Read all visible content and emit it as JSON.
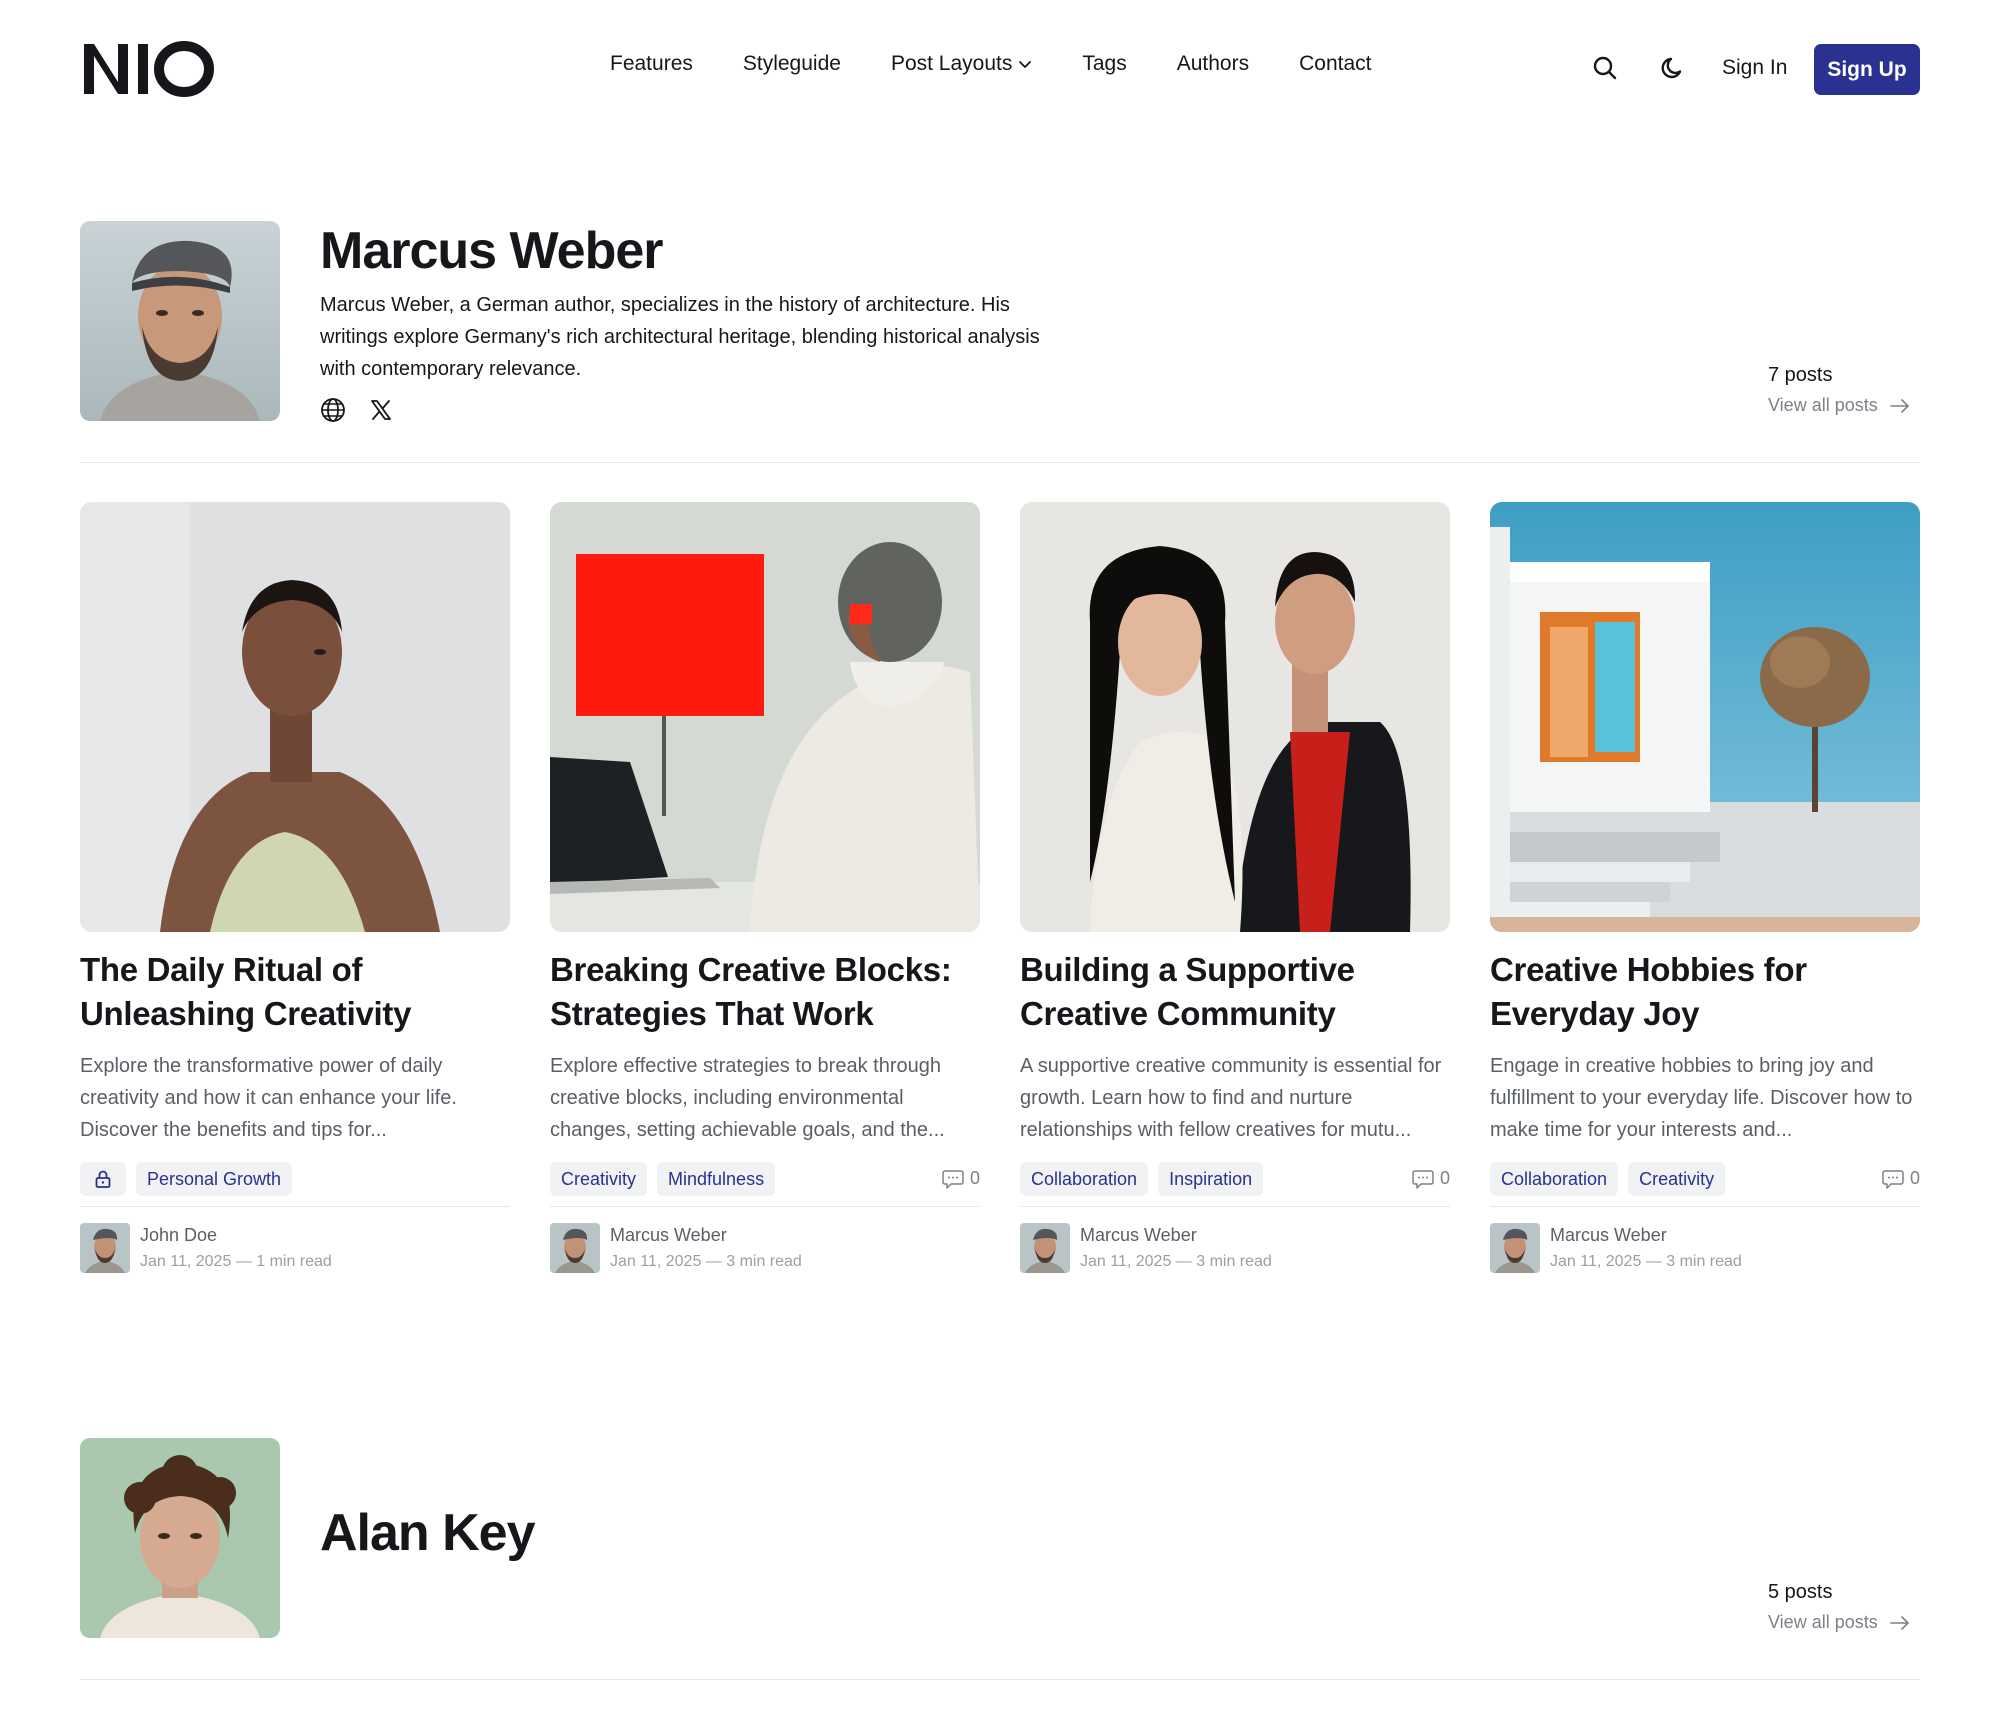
{
  "header": {
    "logo_text": "NIO",
    "nav": [
      {
        "label": "Features"
      },
      {
        "label": "Styleguide"
      },
      {
        "label": "Post Layouts"
      },
      {
        "label": "Tags"
      },
      {
        "label": "Authors"
      },
      {
        "label": "Contact"
      }
    ],
    "signin_label": "Sign In",
    "signup_label": "Sign Up",
    "accent_color": "#2b3190"
  },
  "authors": [
    {
      "name": "Marcus Weber",
      "bio": "Marcus Weber, a German author, specializes in the history of architecture. His writings explore Germany's rich architectural heritage, blending historical analysis with contemporary relevance.",
      "post_count": "7 posts",
      "view_all_label": "View all posts",
      "socials": [
        "globe-icon",
        "x-icon"
      ]
    },
    {
      "name": "Alan Key",
      "post_count": "5 posts",
      "view_all_label": "View all posts"
    }
  ],
  "posts": [
    {
      "title": "The Daily Ritual of Unleashing Creativity",
      "excerpt": "Explore the transformative power of daily creativity and how it can enhance your life. Discover the benefits and tips for...",
      "locked": true,
      "tags": [
        "Personal Growth"
      ],
      "comments": "",
      "author": "John Doe",
      "meta": "Jan 11, 2025 — 1 min read"
    },
    {
      "title": "Breaking Creative Blocks: Strategies That Work",
      "excerpt": "Explore effective strategies to break through creative blocks, including environmental changes, setting achievable goals, and the...",
      "locked": false,
      "tags": [
        "Creativity",
        "Mindfulness"
      ],
      "comments": "0",
      "author": "Marcus Weber",
      "meta": "Jan 11, 2025 — 3 min read"
    },
    {
      "title": "Building a Supportive Creative Community",
      "excerpt": "A supportive creative community is essential for growth. Learn how to find and nurture relationships with fellow creatives for mutu...",
      "locked": false,
      "tags": [
        "Collaboration",
        "Inspiration"
      ],
      "comments": "0",
      "author": "Marcus Weber",
      "meta": "Jan 11, 2025 — 3 min read"
    },
    {
      "title": "Creative Hobbies for Everyday Joy",
      "excerpt": "Engage in creative hobbies to bring joy and fulfillment to your everyday life. Discover how to make time for your interests and...",
      "locked": false,
      "tags": [
        "Collaboration",
        "Creativity"
      ],
      "comments": "0",
      "author": "Marcus Weber",
      "meta": "Jan 11, 2025 — 3 min read"
    }
  ]
}
